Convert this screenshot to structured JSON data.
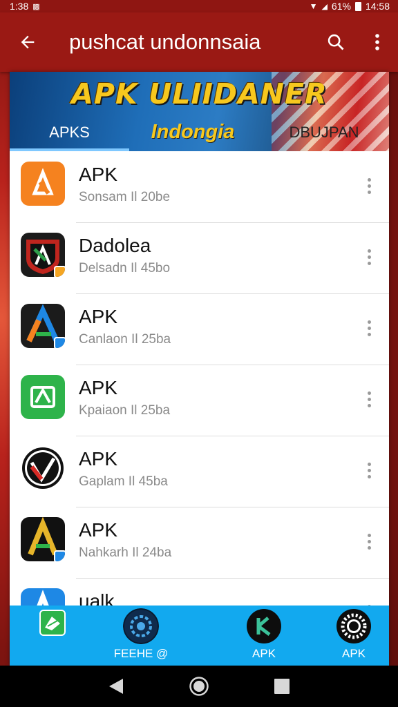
{
  "status_bar": {
    "time_left": "1:38",
    "battery_pct": "61%",
    "clock": "14:58"
  },
  "app_bar": {
    "title": "pushcat undonnsaia",
    "back_icon": "arrow-left-icon",
    "search_icon": "search-icon",
    "menu_icon": "more-vert-icon"
  },
  "banner": {
    "title": "APK ULIIDANER",
    "tabs": [
      {
        "label": "APKS",
        "selected": true
      },
      {
        "label": "Indongia",
        "selected": false
      },
      {
        "label": "DBUJPAN",
        "selected": false
      }
    ]
  },
  "apps": [
    {
      "name": "APK",
      "meta": "Sonsam Il 20be",
      "icon_color": "#f5821f"
    },
    {
      "name": "Dadolea",
      "meta": "Delsadn Il 45bo",
      "icon_color": "#1b1b1b"
    },
    {
      "name": "APK",
      "meta": "Canlaon Il 25ba",
      "icon_color": "#1b1b1b"
    },
    {
      "name": "APK",
      "meta": "Kpaiaon Il 25ba",
      "icon_color": "#2eb34a"
    },
    {
      "name": "APK",
      "meta": "Gaplam Il 45ba",
      "icon_color": "#111111"
    },
    {
      "name": "APK",
      "meta": "Nahkarh Il 24ba",
      "icon_color": "#111111"
    },
    {
      "name": "ualk",
      "meta": "",
      "icon_color": "#1e88e5"
    }
  ],
  "bottom_nav": [
    {
      "label": "",
      "icon": "document-icon"
    },
    {
      "label": "FEEHE @",
      "icon": "cog-circle-icon"
    },
    {
      "label": "APK",
      "icon": "k-logo-icon"
    },
    {
      "label": "APK",
      "icon": "sun-gear-icon"
    }
  ],
  "colors": {
    "app_bar": "#9a1914",
    "bottom_bar": "#12a9ef",
    "accent_yellow": "#f7c81e"
  }
}
